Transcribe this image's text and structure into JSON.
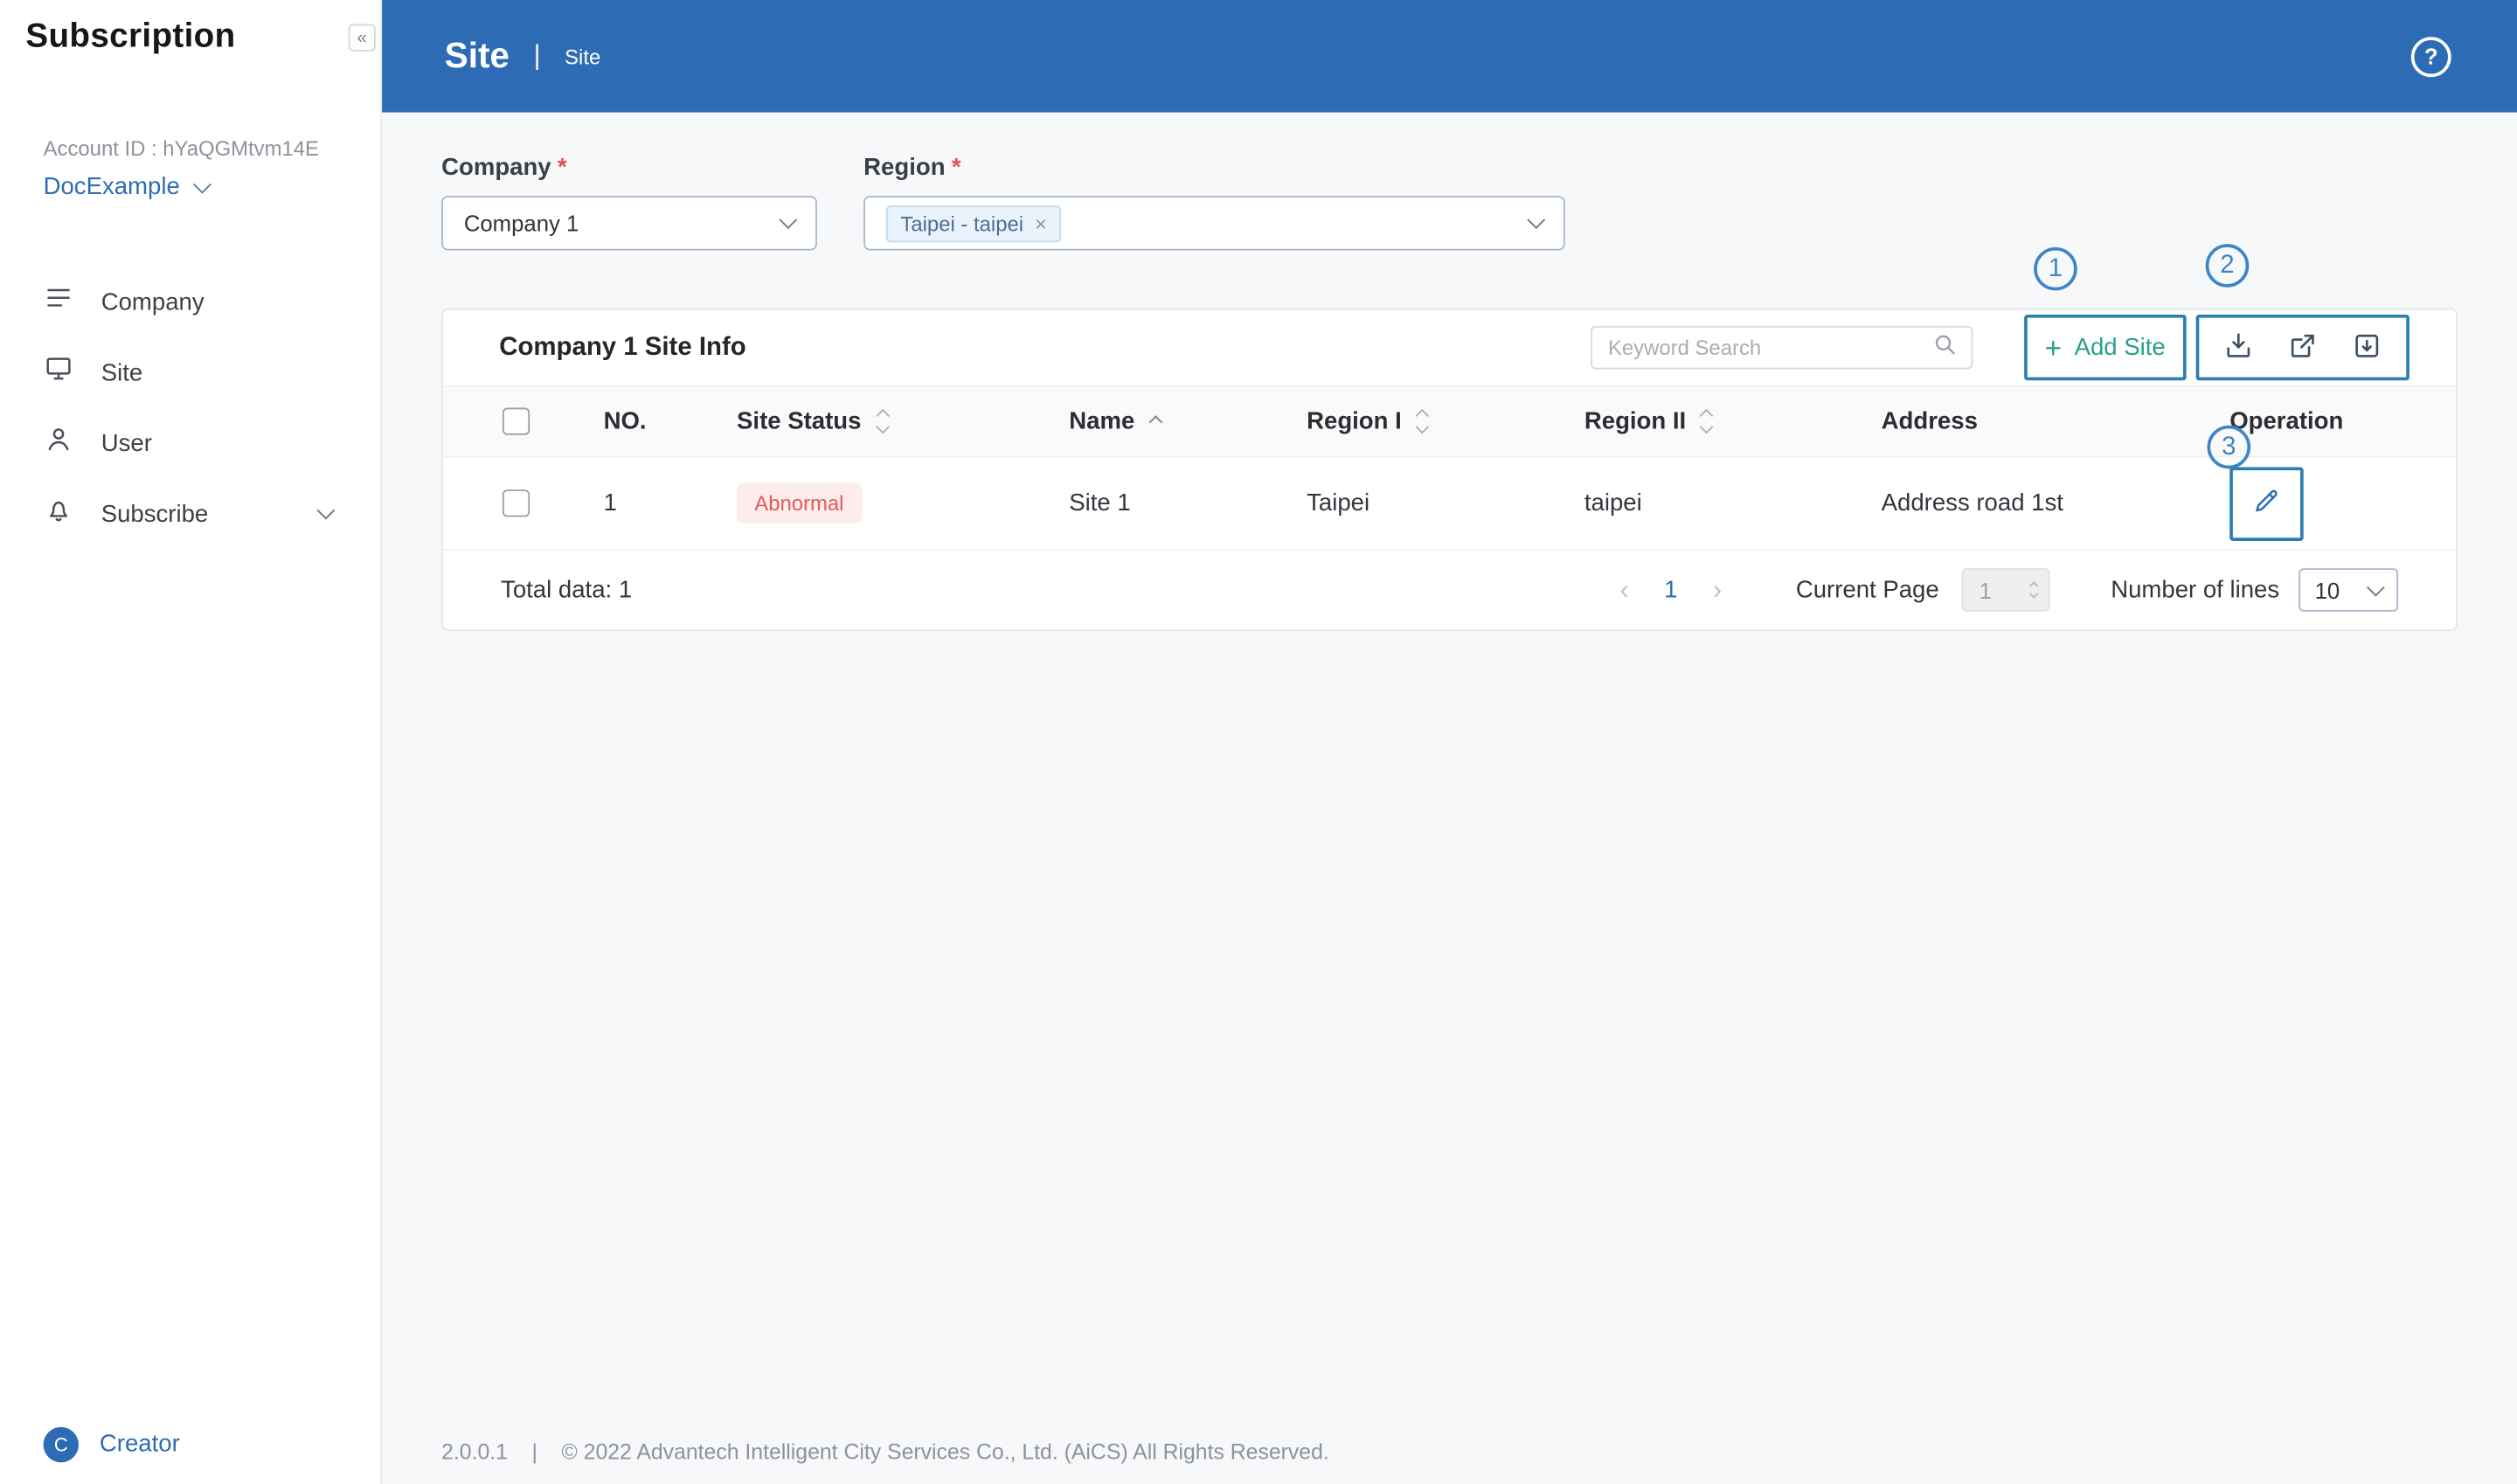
{
  "sidebar": {
    "title": "Subscription",
    "collapse_icon": "«",
    "account_id_label": "Account ID : hYaQGMtvm14E",
    "account_name": "DocExample",
    "items": [
      {
        "label": "Company"
      },
      {
        "label": "Site"
      },
      {
        "label": "User"
      },
      {
        "label": "Subscribe"
      }
    ],
    "footer": {
      "avatar": "C",
      "user": "Creator"
    }
  },
  "header": {
    "title": "Site",
    "separator": "|",
    "breadcrumb": "Site"
  },
  "filters": {
    "company": {
      "label": "Company",
      "required": "*",
      "value": "Company 1"
    },
    "region": {
      "label": "Region",
      "required": "*",
      "tag": "Taipei - taipei",
      "tag_remove": "×"
    }
  },
  "card": {
    "title": "Company 1 Site Info"
  },
  "toolbar": {
    "plus": "+",
    "add_site": "Add Site",
    "search_placeholder": "Keyword Search"
  },
  "annotations": {
    "n1": "1",
    "n2": "2",
    "n3": "3"
  },
  "table": {
    "columns": [
      "NO.",
      "Site Status",
      "Name",
      "Region I",
      "Region II",
      "Address",
      "Operation"
    ],
    "rows": [
      {
        "no": "1",
        "status": "Abnormal",
        "name": "Site 1",
        "region1": "Taipei",
        "region2": "taipei",
        "address": "Address road 1st"
      }
    ]
  },
  "pagination": {
    "total": "Total data: 1",
    "prev": "‹",
    "page": "1",
    "next": "›",
    "current_page_label": "Current Page",
    "current_page_value": "1",
    "lines_label": "Number of lines",
    "lines_value": "10"
  },
  "page_footer": {
    "version": "2.0.0.1",
    "separator": "|",
    "copyright": "© 2022 Advantech Intelligent City Services Co., Ltd. (AiCS) All Rights Reserved."
  },
  "colors": {
    "header_blue": "#2d6cb4",
    "accent_teal": "#2aa08c",
    "annotation_blue": "#2b7fae",
    "badge_text": "#e25b5b",
    "badge_bg": "#fdecec",
    "link_blue": "#2d6cb4"
  }
}
